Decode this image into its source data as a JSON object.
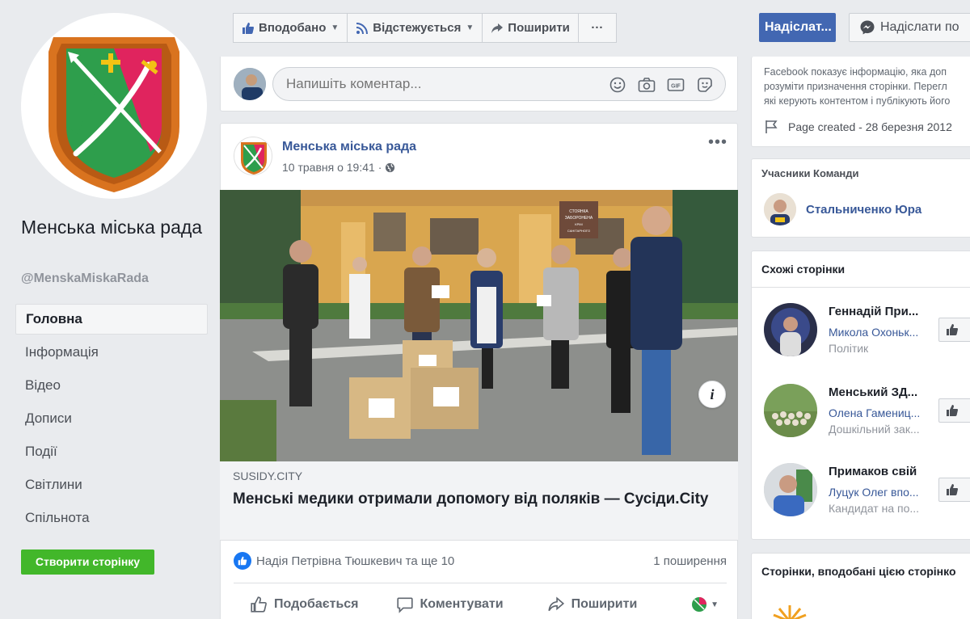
{
  "page": {
    "name": "Менська міська рада",
    "handle": "@MenskaMiskaRada"
  },
  "nav": {
    "items": [
      {
        "label": "Головна",
        "active": true
      },
      {
        "label": "Інформація"
      },
      {
        "label": "Відео"
      },
      {
        "label": "Дописи"
      },
      {
        "label": "Події"
      },
      {
        "label": "Світлини"
      },
      {
        "label": "Спільнота"
      }
    ],
    "create_page_label": "Створити сторінку"
  },
  "action_bar": {
    "liked_label": "Вподобано",
    "following_label": "Відстежується",
    "share_label": "Поширити",
    "more_label": "···"
  },
  "comment_box": {
    "placeholder": "Напишіть коментар..."
  },
  "post": {
    "author": "Менська міська рада",
    "time": "10 травня о 19:41",
    "photo_sign": "СТОЯНКА ЗАБОРОНЕНА КРІМ САНІТАРНОГО ТРАНСПОРТУ",
    "link_domain": "SUSIDY.CITY",
    "link_title": "Менські медики отримали допомогу від поляків — Сусіди.City",
    "reactions_text": "Надія Петрівна Тюшкевич та ще 10",
    "shares_text": "1 поширення",
    "actions": {
      "like": "Подобається",
      "comment": "Коментувати",
      "share": "Поширити"
    }
  },
  "right": {
    "send_button": "Надіслат...",
    "message_button": "Надіслати по",
    "transparency_lines": [
      "Facebook показує інформацію, яка доп",
      "розуміти призначення сторінки. Перегл",
      "які керують контентом і публікують його"
    ],
    "page_created": "Page created - 28 березня 2012",
    "team_title": "Учасники Команди",
    "team_member": "Стальниченко Юра",
    "similar_title": "Схожі сторінки",
    "similar_pages": [
      {
        "name": "Геннадій При...",
        "sub": "Микола Охоньк...",
        "category": "Політик"
      },
      {
        "name": "Менський ЗД...",
        "sub": "Олена Гамениц...",
        "category": "Дошкільний зак..."
      },
      {
        "name": "Примаков свій",
        "sub": "Луцук Олег впо...",
        "category": "Кандидат на по..."
      }
    ],
    "liked_title": "Сторінки, вподобані цією сторінко"
  },
  "colors": {
    "fb_blue": "#4267b2",
    "link_blue": "#385898",
    "green": "#42b72a",
    "background": "#e9ebee"
  }
}
